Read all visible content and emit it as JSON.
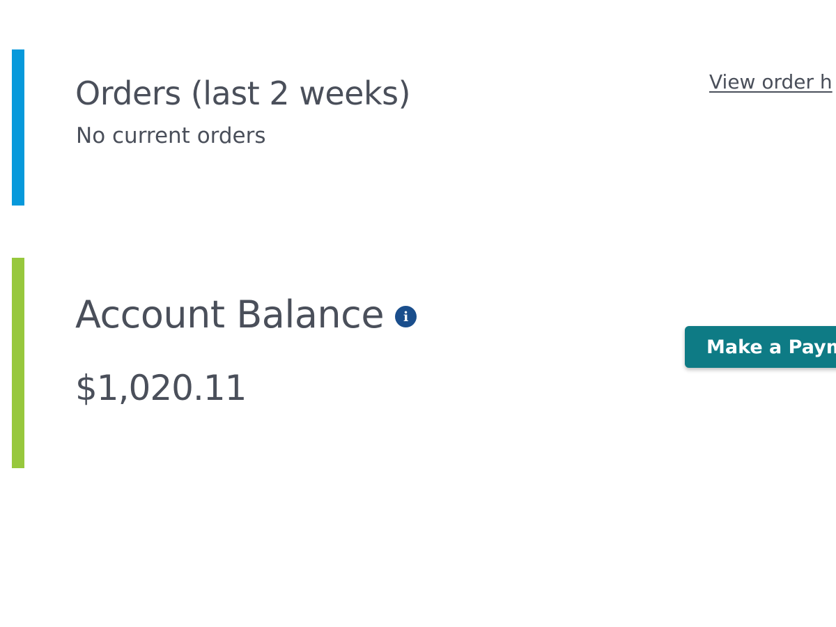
{
  "orders": {
    "title": "Orders (last 2 weeks)",
    "status": "No current orders",
    "history_link": "View order h",
    "accent_color": "#0799db"
  },
  "balance": {
    "title": "Account Balance",
    "info_icon": "info-icon",
    "info_glyph": "i",
    "amount": "$1,020.11",
    "pay_button": "Make a Paym",
    "accent_color": "#97c83d",
    "button_color": "#0e7b85"
  }
}
